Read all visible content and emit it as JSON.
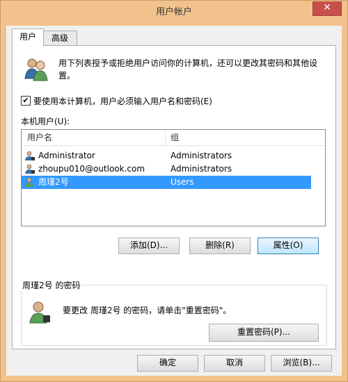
{
  "window": {
    "title": "用户帐户",
    "close_glyph": "✕"
  },
  "tabs": [
    {
      "label": "用户",
      "active": true
    },
    {
      "label": "高级",
      "active": false
    }
  ],
  "intro": {
    "icon": "users-group-icon",
    "text": "用下列表授予或拒绝用户访问你的计算机，还可以更改其密码和其他设置。"
  },
  "require_password": {
    "checked": true,
    "label": "要使用本计算机，用户必须输入用户名和密码(E)"
  },
  "users_label": "本机用户(U):",
  "list": {
    "columns": [
      "用户名",
      "组"
    ],
    "rows": [
      {
        "name": "Administrator",
        "group": "Administrators",
        "selected": false
      },
      {
        "name": "zhoupu010@outlook.com",
        "group": "Administrators",
        "selected": false
      },
      {
        "name": "周瑾2号",
        "group": "Users",
        "selected": true
      }
    ]
  },
  "buttons": {
    "add": "添加(D)...",
    "remove": "删除(R)",
    "properties": "属性(O)"
  },
  "password_group": {
    "title": "周瑾2号 的密码",
    "text": "要更改 周瑾2号 的密码，请单击\"重置密码\"。",
    "reset_button": "重置密码(P)..."
  },
  "footer": {
    "ok": "确定",
    "cancel": "取消",
    "browse": "浏览(B)..."
  },
  "colors": {
    "frame": "#f1c28b",
    "close": "#c7504a",
    "selection": "#3399ff"
  }
}
